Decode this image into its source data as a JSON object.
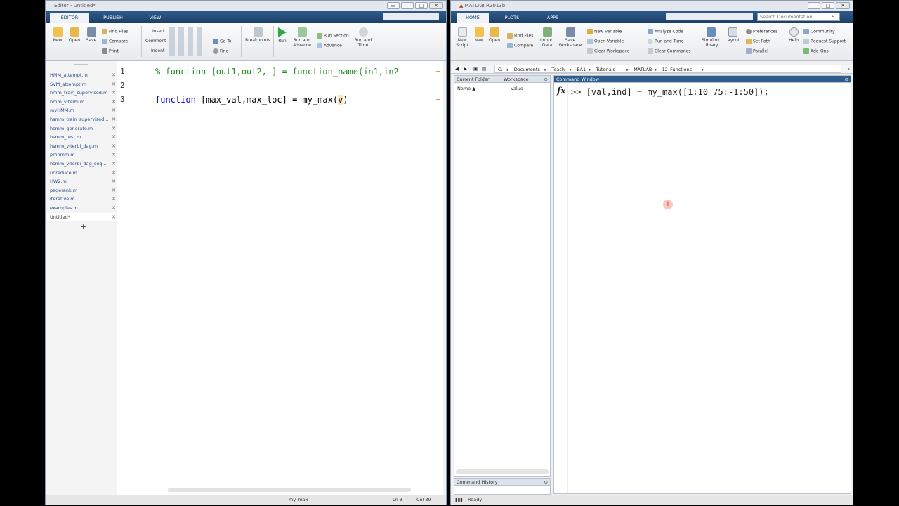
{
  "editor": {
    "title": "Editor - Untitled*",
    "tabs": [
      "EDITOR",
      "PUBLISH",
      "VIEW"
    ],
    "ribbon": {
      "new": "New",
      "open": "Open",
      "save": "Save",
      "find_files": "Find Files",
      "compare": "Compare",
      "print": "Print",
      "insert": "Insert",
      "comment": "Comment",
      "indent": "Indent",
      "go_to": "Go To",
      "find": "Find",
      "breakpoints": "Breakpoints",
      "run": "Run",
      "run_and_advance": "Run and Advance",
      "run_section": "Run Section",
      "advance": "Advance",
      "run_and_time": "Run and Time"
    },
    "files": [
      "HMM_attempt.m",
      "SVM_attempt.m",
      "hmm_train_supervised.m",
      "hmm_viterbi.m",
      "myHMM.m",
      "hsmm_train_supervised...",
      "hsmm_generate.m",
      "hsmm_test.m",
      "hsmm_viterbi_dag.m",
      "pmhmm.m",
      "hsmm_viterbi_dag_seq...",
      "unreduce.m",
      "HW2.m",
      "pagerank.m",
      "iterative.m",
      "examples.m",
      "Untitled*"
    ],
    "add_tab": "+",
    "line_numbers": [
      "1",
      "2",
      "3"
    ],
    "code": {
      "line1": "% function [out1,out2, ] = function_name(in1,in2",
      "line3_kw": "function",
      "line3_rest": " [max_val,max_loc] = my_max(",
      "line3_arg": "v",
      "line3_end": ")"
    },
    "status": {
      "func": "my_max",
      "ln": "Ln  3",
      "col": "Col  39"
    }
  },
  "matlab": {
    "title": "MATLAB R2013b",
    "tabs": [
      "HOME",
      "PLOTS",
      "APPS"
    ],
    "search_placeholder": "Search Documentation",
    "ribbon": {
      "new_script": "New Script",
      "new": "New",
      "open": "Open",
      "find_files": "Find Files",
      "compare": "Compare",
      "import_data": "Import Data",
      "save_workspace": "Save Workspace",
      "new_variable": "New Variable",
      "open_variable": "Open Variable",
      "clear_workspace": "Clear Workspace",
      "analyze_code": "Analyze Code",
      "run_and_time": "Run and Time",
      "clear_commands": "Clear Commands",
      "simulink": "Simulink Library",
      "layout": "Layout",
      "preferences": "Preferences",
      "set_path": "Set Path",
      "parallel": "Parallel",
      "help": "Help",
      "community": "Community",
      "request_support": "Request Support",
      "add_ons": "Add-Ons"
    },
    "path": [
      "C:",
      "Documents",
      "Teach",
      "EA1",
      "Tutorials",
      "MATLAB",
      "12_Functions"
    ],
    "current_folder_tab": "Current Folder",
    "workspace_tab": "Workspace",
    "ws_cols": [
      "Name ▲",
      "Value"
    ],
    "command_window_title": "Command Window",
    "command": ">> [val,ind] = my_max([1:10 75:-1:50]);",
    "command_history": "Command History",
    "status": "Ready"
  },
  "colors": {
    "keyword": "#0000ff",
    "comment": "#228b22",
    "tabbar": "#1d3f66",
    "file_link": "#2b4e8c"
  }
}
